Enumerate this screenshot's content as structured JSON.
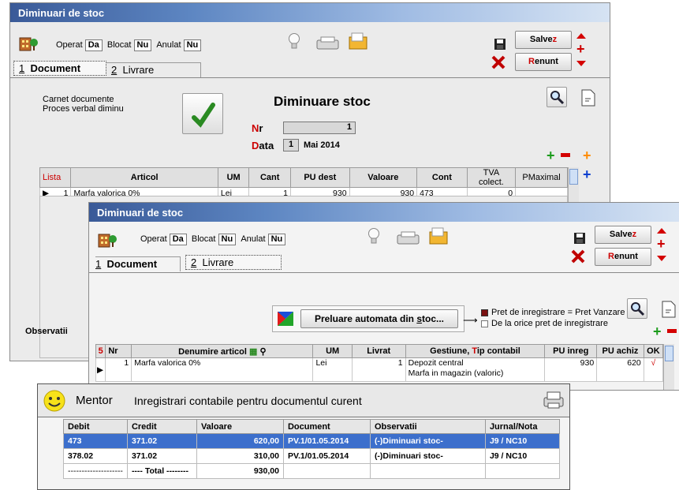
{
  "win1": {
    "title": "Diminuari de stoc",
    "operat_label": "Operat",
    "operat_val": "Da",
    "blocat_label": "Blocat",
    "blocat_val": "Nu",
    "anulat_label": "Anulat",
    "anulat_val": "Nu",
    "tab1_num": "1",
    "tab1_label": "Document",
    "tab2_num": "2",
    "tab2_label": "Livrare",
    "save_label_pre": "Salve",
    "save_label_acc": "z",
    "cancel_label_acc": "R",
    "cancel_label_post": "enunt",
    "carnet_label": "Carnet documente",
    "carnet_value": "Proces verbal diminu",
    "doc_title": "Diminuare stoc",
    "nr_label_acc": "N",
    "nr_label_post": "r",
    "nr_value": "1",
    "data_label_acc": "D",
    "data_label_post": "ata",
    "data_day": "1",
    "data_month_year": "Mai 2014",
    "columns": [
      "Lista",
      "Articol",
      "UM",
      "Cant",
      "PU dest",
      "Valoare",
      "Cont",
      "TVA colect.",
      "PMaximal"
    ],
    "rows": [
      {
        "nr": "1",
        "articol": "Marfa valorica 0%",
        "um": "Lei",
        "cant": "1",
        "pu_dest": "930",
        "valoare": "930",
        "cont": "473",
        "tva": "0",
        "pmax": ""
      }
    ],
    "observatii_label": "Observatii"
  },
  "win2": {
    "title": "Diminuari de stoc",
    "operat_label": "Operat",
    "operat_val": "Da",
    "blocat_label": "Blocat",
    "blocat_val": "Nu",
    "anulat_label": "Anulat",
    "anulat_val": "Nu",
    "tab1_num": "1",
    "tab1_label": "Document",
    "tab2_num": "2",
    "tab2_label": "Livrare",
    "save_label_pre": "Salve",
    "save_label_acc": "z",
    "cancel_label_acc": "R",
    "cancel_label_post": "enunt",
    "preluare_label_pre": "Preluare automata din ",
    "preluare_label_acc": "s",
    "preluare_label_post": "toc...",
    "option1": "Pret de inregistrare = Pret Vanzare",
    "option2": "De la orice pret de inregistrare",
    "row_count": "5",
    "columns": {
      "nr": "Nr",
      "denumire": "Denumire articol",
      "um": "UM",
      "livrat": "Livrat",
      "gestiune_pre": "Gestiune, ",
      "gestiune_acc": "T",
      "gestiune_post": "ip contabil",
      "pu_inreg": "PU inreg",
      "pu_achiz": "PU achiz",
      "ok": "OK"
    },
    "rows": [
      {
        "nr": "1",
        "denumire": "Marfa valorica 0%",
        "um": "Lei",
        "livrat": "1",
        "gestiune": "Depozit central",
        "tip": "Marfa in magazin (valoric)",
        "pu_inreg": "930",
        "pu_achiz": "620",
        "ok": "√"
      }
    ]
  },
  "mentor": {
    "name": "Mentor",
    "title": "Inregistrari contabile pentru documentul curent",
    "columns": [
      "Debit",
      "Credit",
      "Valoare",
      "Document",
      "Observatii",
      "Jurnal/Nota"
    ],
    "rows": [
      {
        "debit": "473",
        "credit": "371.02",
        "valoare": "620,00",
        "document": "PV.1/01.05.2014",
        "obs": "(-)Diminuari stoc-",
        "jurnal": "J9 / NC10"
      },
      {
        "debit": "378.02",
        "credit": "371.02",
        "valoare": "310,00",
        "document": "PV.1/01.05.2014",
        "obs": "(-)Diminuari stoc-",
        "jurnal": "J9 / NC10"
      }
    ],
    "total_debit": "--------------------",
    "total_label": "---- Total --------",
    "total_value": "930,00"
  },
  "colors": {
    "accent_red": "#cc0000",
    "selection_blue": "#3c6fcc",
    "title_blue": "#3a5a98"
  }
}
